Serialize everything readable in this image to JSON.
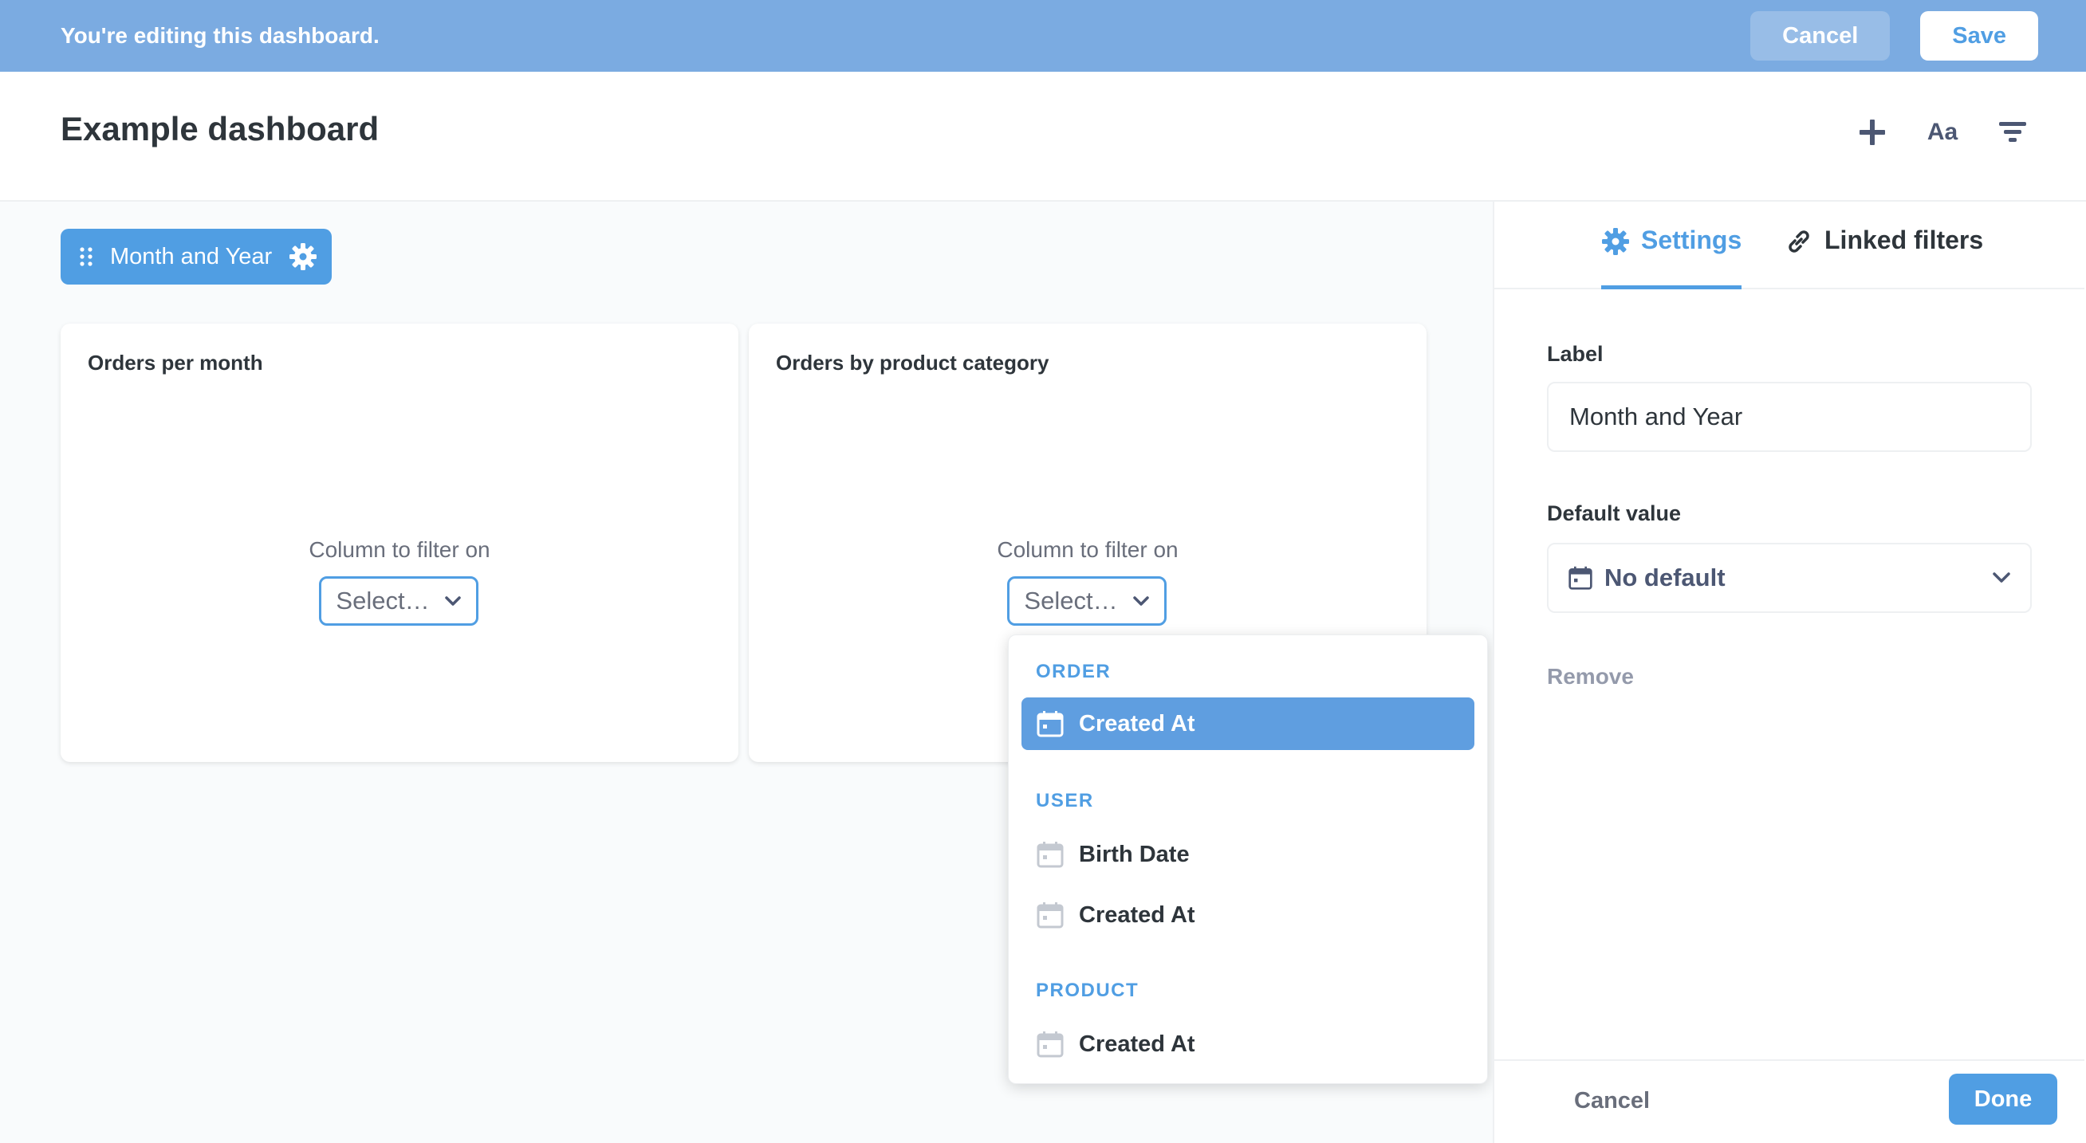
{
  "edit_banner": {
    "message": "You're editing this dashboard.",
    "cancel_label": "Cancel",
    "save_label": "Save"
  },
  "dashboard": {
    "title": "Example dashboard",
    "tools": [
      "add-icon",
      "text-icon",
      "filter-icon"
    ],
    "text_tool_label": "Aa"
  },
  "filter_chip": {
    "label": "Month and Year"
  },
  "cards": [
    {
      "title": "Orders per month",
      "filter_label": "Column to filter on",
      "select_placeholder": "Select…"
    },
    {
      "title": "Orders by product category",
      "filter_label": "Column to filter on",
      "select_placeholder": "Select…"
    }
  ],
  "dropdown": {
    "sections": [
      {
        "name": "ORDER",
        "items": [
          "Created At"
        ]
      },
      {
        "name": "USER",
        "items": [
          "Birth Date",
          "Created At"
        ]
      },
      {
        "name": "PRODUCT",
        "items": [
          "Created At"
        ]
      }
    ],
    "selected": "ORDER / Created At"
  },
  "sidebar": {
    "tabs": [
      {
        "label": "Settings",
        "active": true
      },
      {
        "label": "Linked filters",
        "active": false
      }
    ],
    "label_field": {
      "label": "Label",
      "value": "Month and Year"
    },
    "default_field": {
      "label": "Default value",
      "value": "No default"
    },
    "remove_label": "Remove",
    "footer": {
      "cancel_label": "Cancel",
      "done_label": "Done"
    }
  },
  "colors": {
    "brand": "#509ee3",
    "banner": "#7babe1",
    "text_dark": "#2e353b",
    "text_medium": "#696e7b"
  }
}
